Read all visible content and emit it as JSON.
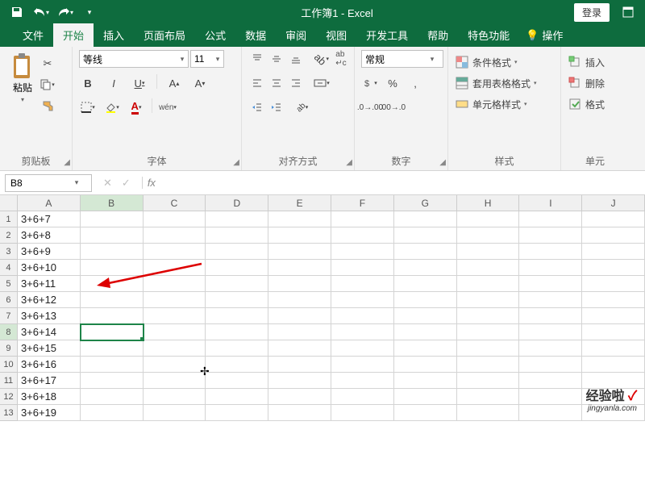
{
  "title": "工作簿1 - Excel",
  "login": "登录",
  "tabs": [
    "文件",
    "开始",
    "插入",
    "页面布局",
    "公式",
    "数据",
    "审阅",
    "视图",
    "开发工具",
    "帮助",
    "特色功能"
  ],
  "active_tab": 1,
  "tell_me": "操作",
  "groups": {
    "clipboard": {
      "label": "剪贴板",
      "paste": "粘贴"
    },
    "font": {
      "label": "字体",
      "name": "等线",
      "size": "11"
    },
    "align": {
      "label": "对齐方式"
    },
    "number": {
      "label": "数字",
      "format": "常规"
    },
    "styles": {
      "label": "样式",
      "cond": "条件格式",
      "table": "套用表格格式",
      "cell": "单元格样式"
    },
    "cells": {
      "label": "单元",
      "insert": "插入",
      "delete": "删除",
      "format": "格式"
    }
  },
  "namebox": "B8",
  "fx": "fx",
  "columns": [
    "A",
    "B",
    "C",
    "D",
    "E",
    "F",
    "G",
    "H",
    "I",
    "J"
  ],
  "rows": [
    {
      "n": 1,
      "a": "3+6+7"
    },
    {
      "n": 2,
      "a": "3+6+8"
    },
    {
      "n": 3,
      "a": "3+6+9"
    },
    {
      "n": 4,
      "a": "3+6+10"
    },
    {
      "n": 5,
      "a": "3+6+11"
    },
    {
      "n": 6,
      "a": "3+6+12"
    },
    {
      "n": 7,
      "a": "3+6+13"
    },
    {
      "n": 8,
      "a": "3+6+14"
    },
    {
      "n": 9,
      "a": "3+6+15"
    },
    {
      "n": 10,
      "a": "3+6+16"
    },
    {
      "n": 11,
      "a": "3+6+17"
    },
    {
      "n": 12,
      "a": "3+6+18"
    },
    {
      "n": 13,
      "a": "3+6+19"
    }
  ],
  "active_cell": {
    "row": 8,
    "col": "B"
  },
  "watermark": "经验啦",
  "watermark_sub": "jingyanla.com"
}
